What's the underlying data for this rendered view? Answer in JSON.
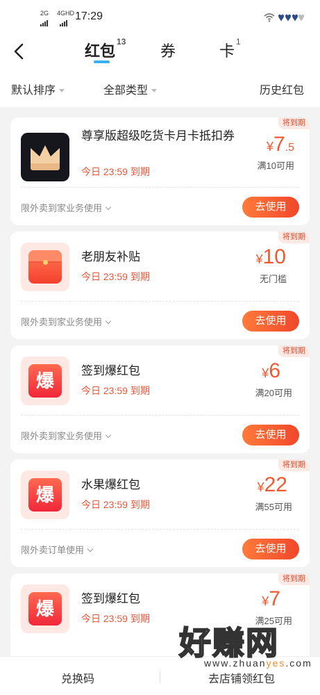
{
  "status_bar": {
    "signal_1": "2G",
    "signal_2": "4GHD",
    "time": "17:29",
    "right_icons": "wifi-icon battery-icon"
  },
  "nav": {
    "tabs": [
      {
        "label": "红包",
        "count": "13",
        "active": true
      },
      {
        "label": "券",
        "count": "",
        "active": false
      },
      {
        "label": "卡",
        "count": "1",
        "active": false
      }
    ]
  },
  "filters": {
    "sort": "默认排序",
    "type": "全部类型",
    "history": "历史红包"
  },
  "cards": [
    {
      "badge": "将到期",
      "title": "尊享版超级吃货卡月卡抵扣券",
      "expire": "今日 23:59 到期",
      "yen": "¥",
      "amount": "7",
      "decimal": ".5",
      "condition": "满10可用",
      "scope": "限外卖到家业务使用",
      "button": "去使用",
      "icon": "crown-icon"
    },
    {
      "badge": "将到期",
      "title": "老朋友补贴",
      "expire": "今日 23:59 到期",
      "yen": "¥",
      "amount": "10",
      "decimal": "",
      "condition": "无门槛",
      "scope": "限外卖到家业务使用",
      "button": "去使用",
      "icon": "red-packet-icon"
    },
    {
      "badge": "将到期",
      "title": "签到爆红包",
      "expire": "今日 23:59 到期",
      "yen": "¥",
      "amount": "6",
      "decimal": "",
      "condition": "满20可用",
      "scope": "限外卖到家业务使用",
      "button": "去使用",
      "icon_text": "爆"
    },
    {
      "badge": "将到期",
      "title": "水果爆红包",
      "expire": "今日 23:59 到期",
      "yen": "¥",
      "amount": "22",
      "decimal": "",
      "condition": "满55可用",
      "scope": "限外卖订单使用",
      "button": "去使用",
      "icon_text": "爆"
    },
    {
      "badge": "将到期",
      "title": "签到爆红包",
      "expire": "今日 23:59 到期",
      "yen": "¥",
      "amount": "7",
      "decimal": "",
      "condition": "满25可用",
      "icon_text": "爆"
    }
  ],
  "bottom_bar": {
    "left": "兑换码",
    "right": "去店铺领红包"
  },
  "watermark": {
    "big": "好赚网",
    "small_prefix": "www.zhuan",
    "small_highlight": "yes",
    "small_suffix": ".com"
  },
  "colors": {
    "accent": "#ef5a32",
    "tab_underline": "#3bb0f0",
    "badge_bg": "#fde9e3"
  }
}
